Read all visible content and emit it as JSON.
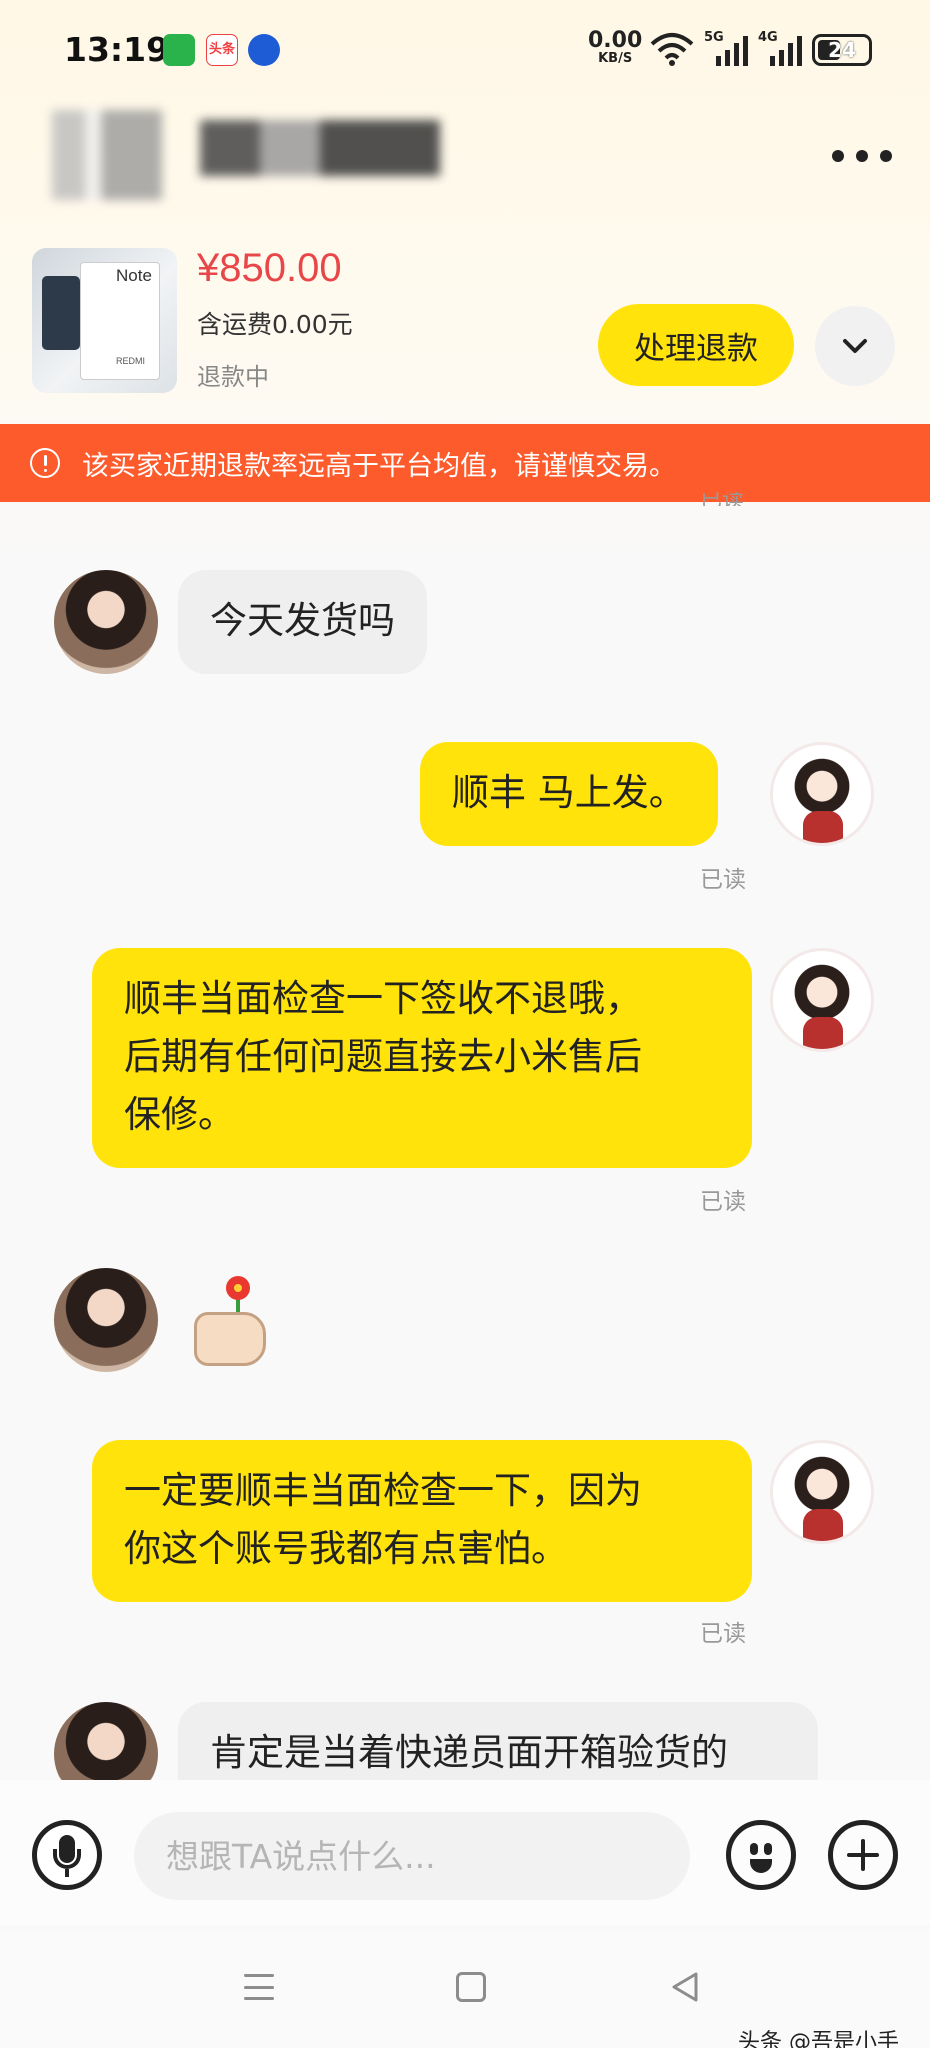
{
  "status_bar": {
    "time": "13:19",
    "toutiao_badge": "头条",
    "net_speed": "0.00",
    "net_speed_unit": "KB/S",
    "signal_1": "5G",
    "signal_2": "4G",
    "battery": "24"
  },
  "product": {
    "thumb_brand": "Note",
    "thumb_maker": "REDMI",
    "price": "¥850.00",
    "shipping": "含运费0.00元",
    "status": "退款中",
    "refund_button": "处理退款"
  },
  "warning": {
    "text": "该买家近期退款率远高于平台均值，请谨慎交易。"
  },
  "messages": [
    {
      "side": "in",
      "text": "今天发货吗"
    },
    {
      "side": "out",
      "text": "顺丰  马上发。",
      "read": "已读"
    },
    {
      "side": "out",
      "lines": [
        "顺丰当面检查一下签收不退哦，",
        "后期有任何问题直接去小米售后",
        "保修。"
      ],
      "read": "已读"
    },
    {
      "side": "in",
      "emoji": "thumbs-up-flower"
    },
    {
      "side": "out",
      "lines": [
        "一定要顺丰当面检查一下，因为",
        "你这个账号我都有点害怕。"
      ],
      "read": "已读"
    },
    {
      "side": "in",
      "text": "肯定是当着快递员面开箱验货的"
    }
  ],
  "read_peek": "已读",
  "input": {
    "placeholder": "想跟TA说点什么..."
  },
  "watermark": "头条 @吾是小手",
  "colors": {
    "accent_yellow": "#ffe30a",
    "warning_orange": "#fe5b2c",
    "price_red": "#e8474a"
  }
}
